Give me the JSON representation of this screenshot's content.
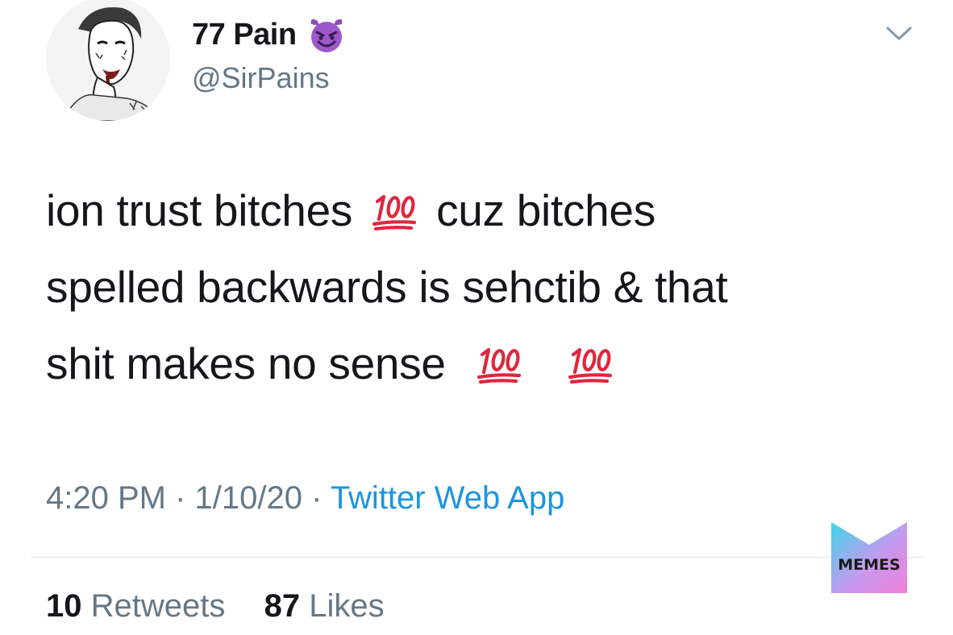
{
  "author": {
    "display_name": "77 Pain",
    "handle": "@SirPains",
    "avatar_icon": "avatar-sketch-icon",
    "name_emoji": "smiling-devil-icon"
  },
  "tweet": {
    "lines": [
      {
        "before": "ion trust bitches",
        "after": "cuz bitches"
      },
      {
        "text": "spelled backwards is sehctib & that"
      },
      {
        "text": "shit makes no sense"
      }
    ],
    "emoji": "hundred-points-icon"
  },
  "meta": {
    "time": "4:20 PM",
    "sep1": " · ",
    "date": "1/10/20",
    "sep2": " · ",
    "source": "Twitter Web App"
  },
  "stats": {
    "retweets_count": "10",
    "retweets_label": "Retweets",
    "likes_count": "87",
    "likes_label": "Likes"
  },
  "watermark": {
    "label": "MEMES"
  },
  "colors": {
    "text": "#14171a",
    "muted": "#657786",
    "link": "#1b95e0",
    "divider": "#e1e8ed",
    "hundred_red": "#e0263e",
    "devil_purple": "#8c4fbf"
  }
}
